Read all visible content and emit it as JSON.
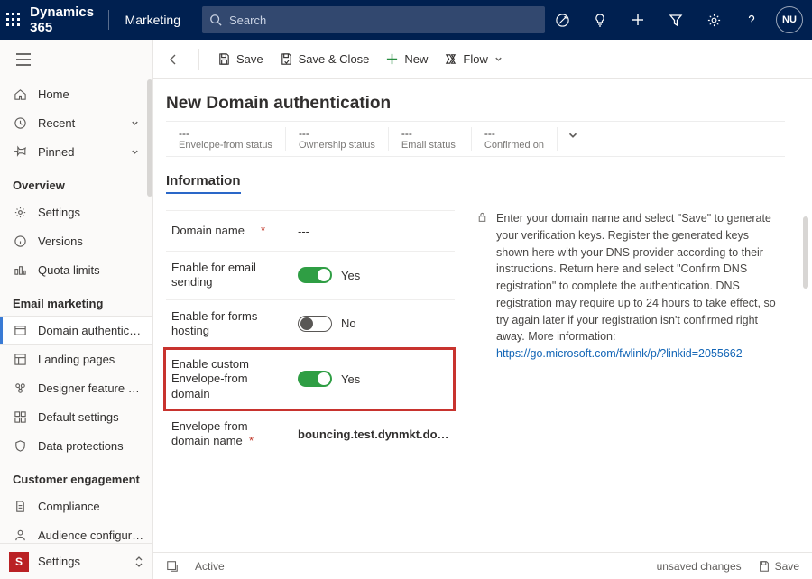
{
  "top": {
    "brand": "Dynamics 365",
    "module": "Marketing",
    "search_placeholder": "Search",
    "avatar": "NU"
  },
  "sidebar": {
    "items": {
      "home": "Home",
      "recent": "Recent",
      "pinned": "Pinned"
    },
    "overview_title": "Overview",
    "overview": {
      "settings": "Settings",
      "versions": "Versions",
      "quota": "Quota limits"
    },
    "email_title": "Email marketing",
    "email": {
      "domain": "Domain authentic…",
      "landing": "Landing pages",
      "designer": "Designer feature …",
      "defaults": "Default settings",
      "data": "Data protections"
    },
    "engage_title": "Customer engagement",
    "engage": {
      "compliance": "Compliance",
      "audience": "Audience configur…"
    },
    "bottom_label": "Settings",
    "bottom_letter": "S"
  },
  "cmd": {
    "save": "Save",
    "save_close": "Save & Close",
    "new": "New",
    "flow": "Flow"
  },
  "page": {
    "title": "New Domain authentication",
    "status": {
      "envelope_val": "---",
      "envelope_lbl": "Envelope-from status",
      "ownership_val": "---",
      "ownership_lbl": "Ownership status",
      "email_val": "---",
      "email_lbl": "Email status",
      "confirmed_val": "---",
      "confirmed_lbl": "Confirmed on"
    },
    "tab": "Information",
    "form": {
      "domain_name_lbl": "Domain name",
      "domain_name_val": "---",
      "enable_email_lbl": "Enable for email sending",
      "yes": "Yes",
      "no": "No",
      "enable_forms_lbl": "Enable for forms hosting",
      "enable_custom_lbl": "Enable custom Envelope-from domain",
      "envelope_domain_lbl": "Envelope-from domain name",
      "envelope_domain_val": "bouncing.test.dynmkt.do…"
    },
    "info_text": "Enter your domain name and select \"Save\" to generate your verification keys. Register the generated keys shown here with your DNS provider according to their instructions. Return here and select \"Confirm DNS registration\" to complete the authentication. DNS registration may require up to 24 hours to take effect, so try again later if your registration isn't confirmed right away. More information: ",
    "info_link": "https://go.microsoft.com/fwlink/p/?linkid=2055662"
  },
  "footer": {
    "status": "Active",
    "unsaved": "unsaved changes",
    "save": "Save"
  }
}
